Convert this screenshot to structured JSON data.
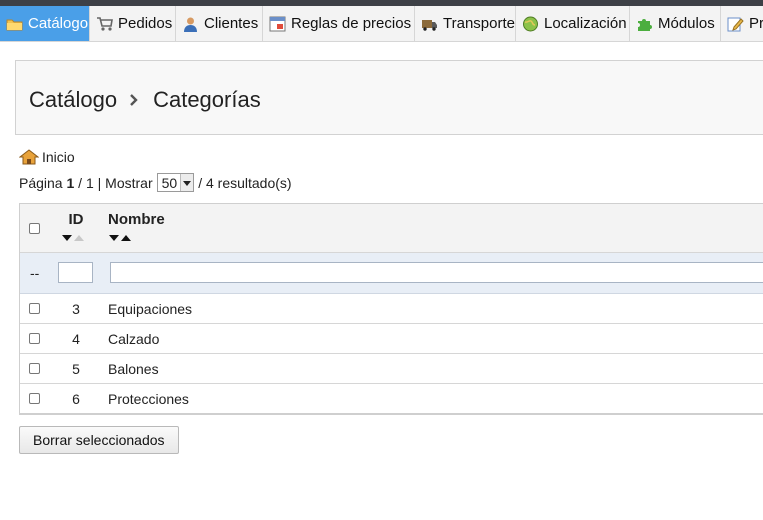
{
  "nav": {
    "tabs": [
      {
        "label": "Catálogo",
        "icon": "folder-icon",
        "active": true
      },
      {
        "label": "Pedidos",
        "icon": "cart-icon",
        "active": false
      },
      {
        "label": "Clientes",
        "icon": "user-icon",
        "active": false
      },
      {
        "label": "Reglas de precios",
        "icon": "price-rules-icon",
        "active": false
      },
      {
        "label": "Transporte",
        "icon": "truck-icon",
        "active": false
      },
      {
        "label": "Localización",
        "icon": "globe-icon",
        "active": false
      },
      {
        "label": "Módulos",
        "icon": "puzzle-icon",
        "active": false
      },
      {
        "label": "Pr",
        "icon": "edit-icon",
        "active": false
      }
    ]
  },
  "breadcrumb": {
    "root": "Catálogo",
    "separator": "›",
    "current": "Categorías"
  },
  "home_link": "Inicio",
  "pagination": {
    "page_label": "Página",
    "current_page": "1",
    "of": "/ 1",
    "show_label": "| Mostrar",
    "per_page": "50",
    "results": "/ 4 resultado(s)"
  },
  "table": {
    "columns": {
      "id": "ID",
      "name": "Nombre"
    },
    "filter": {
      "placeholder_dash": "--"
    },
    "rows": [
      {
        "id": "3",
        "name": "Equipaciones"
      },
      {
        "id": "4",
        "name": "Calzado"
      },
      {
        "id": "5",
        "name": "Balones"
      },
      {
        "id": "6",
        "name": "Protecciones"
      }
    ]
  },
  "actions": {
    "delete_selected": "Borrar seleccionados"
  },
  "colors": {
    "active_tab": "#4a9fe8",
    "topbar": "#3d4046",
    "filter_row": "#e8eef6"
  }
}
